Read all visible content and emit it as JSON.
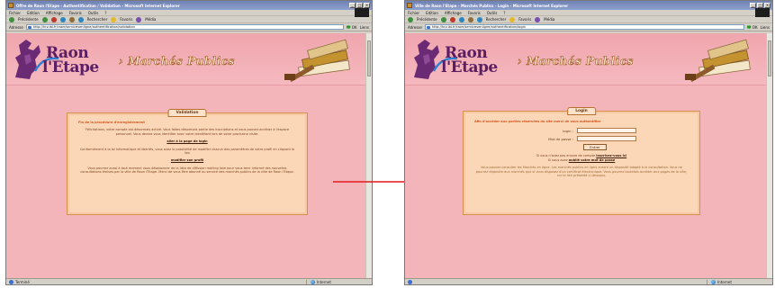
{
  "left_window": {
    "title": "Offre de Raon l'Etape - Authentification / Validation - Microsoft Internet Explorer",
    "menu": [
      "Fichier",
      "Edition",
      "Affichage",
      "Favoris",
      "Outils",
      "?"
    ],
    "toolbar": [
      "Précédente",
      "Rechercher",
      "Favoris",
      "Média"
    ],
    "address_label": "Adresse",
    "address_url": "http://hrv.ibi.fr/raon/servicesenligne/authentification/validation",
    "go_label": "OK",
    "liens_label": "Liens",
    "status_text": "Terminé",
    "status_zone": "Internet",
    "site": {
      "logo_line1": "Raon",
      "logo_line2": "l'Etape",
      "section": "Marchés Publics"
    },
    "panel": {
      "tab": "Validation",
      "heading": "Fin de la procédure d'enregistrement",
      "para1": "Félicitations, votre compte est désormais activé. Vous faites désormais partie des inscriptions et vous pouvez accéder à l'espace personnel. Vous devrez vous identifier avec votre identifiant lors de votre prochaine visite.",
      "link1": "aller à la page de login",
      "para2": "Conformément à la loi informatique et libertés, vous avez la possibilité de modifier chacun des paramètres de votre profil en cliquant le lien",
      "link2": "modifier son profil",
      "para3": "Vous pourrez aussi à tout moment vous désabonner de la liste de diffusion mailing liste pour vous tenir informé des nouvelles consultations émises par la ville de Raon l'Etape. Merci de vous être abonné au service des marchés publics de la ville de Raon l'Etape."
    }
  },
  "right_window": {
    "title": "Ville de Raon l'Etape - Marchés Publics - Login - Microsoft Internet Explorer",
    "menu": [
      "Fichier",
      "Edition",
      "Affichage",
      "Favoris",
      "Outils",
      "?"
    ],
    "toolbar": [
      "Précédente",
      "Rechercher",
      "Favoris",
      "Média"
    ],
    "address_label": "Adresse",
    "address_url": "http://hrv.ibi.fr/raon/servicesenligne/authentification/login",
    "go_label": "OK",
    "liens_label": "Liens",
    "status_text": "",
    "status_zone": "Internet",
    "site": {
      "logo_line1": "Raon",
      "logo_line2": "l'Etape",
      "section": "Marchés Publics"
    },
    "panel": {
      "tab": "Login",
      "heading": "Afin d'accéder aux parties réservées du site merci de vous authentifier",
      "login_label": "login :",
      "password_label": "Mot de passe :",
      "submit_label": "Entrer",
      "note_text": "Si vous n'avez pas encore de compte",
      "note_link1": "inscrivez-vous ici",
      "note_text2": "Si vous avez",
      "note_link2": "oublié votre mot de passe",
      "foot": "Vous pouvez consulter les Marchés en ligne. Les marchés publics en ligne auront un dispositif adapté à la consultation. Vous ne pourrez répondre aux marchés que si vous disposez d'un certificat électronique. Vous pourrez toutefois accéder aux pages de la ville, sur le lien présenté ci-dessous."
    }
  },
  "colors": {
    "page_pink": "#f4b5ba",
    "panel_bg": "#fbd7b7",
    "logo_purple": "#5b1e63",
    "arrow_red": "#e3191c"
  }
}
